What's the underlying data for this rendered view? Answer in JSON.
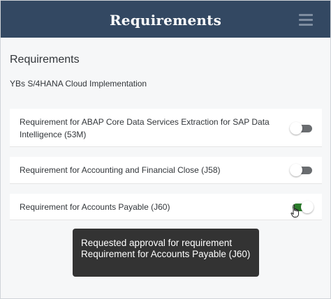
{
  "header": {
    "title": "Requirements",
    "menu_icon": "hamburger-menu-icon",
    "background": "#334862"
  },
  "page": {
    "title": "Requirements",
    "project_name": "YBs S/4HANA Cloud Implementation"
  },
  "requirements": [
    {
      "label": "Requirement for ABAP Core Data Services Extraction for SAP Data Intelligence (53M)",
      "enabled": false
    },
    {
      "label": "Requirement for Accounting and Financial Close (J58)",
      "enabled": false
    },
    {
      "label": "Requirement for Accounts Payable (J60)",
      "enabled": true
    }
  ],
  "toast": {
    "message": "Requested approval for requirement Requirement for Accounts Payable (J60)"
  },
  "colors": {
    "toggle_on": "#2b7d2b",
    "toggle_off": "#6a6d70",
    "toast_background": "#333333"
  }
}
